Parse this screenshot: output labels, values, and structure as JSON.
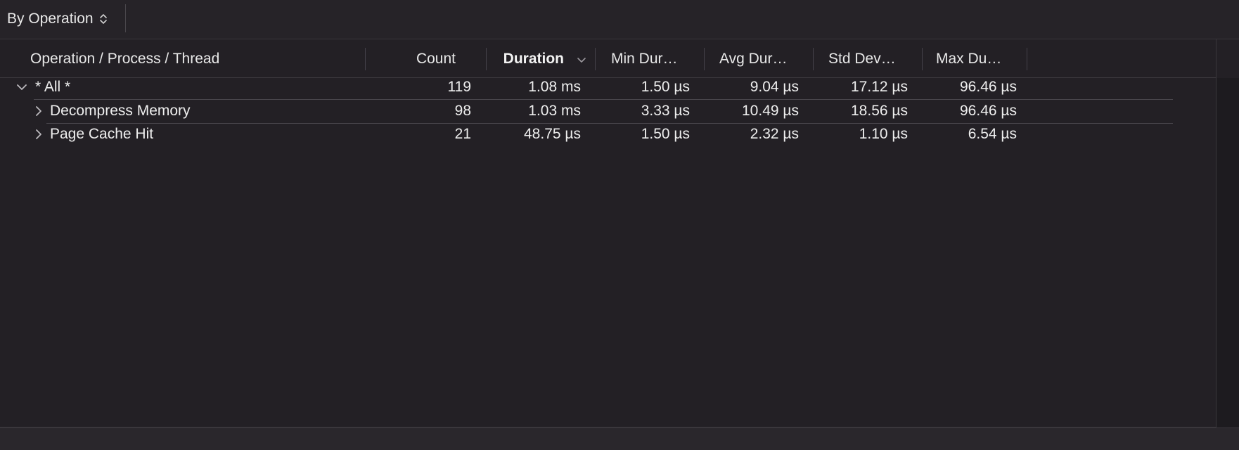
{
  "toolbar": {
    "scope_label": "By Operation"
  },
  "columns": [
    {
      "key": "name",
      "label": "Operation / Process / Thread"
    },
    {
      "key": "count",
      "label": "Count"
    },
    {
      "key": "duration",
      "label": "Duration"
    },
    {
      "key": "min",
      "label": "Min Dur…"
    },
    {
      "key": "avg",
      "label": "Avg Dur…"
    },
    {
      "key": "std",
      "label": "Std Dev…"
    },
    {
      "key": "max",
      "label": "Max Du…"
    }
  ],
  "rows": [
    {
      "name": "* All *",
      "expanded": true,
      "count": "119",
      "duration": "1.08 ms",
      "min": "1.50 µs",
      "avg": "9.04 µs",
      "std": "17.12 µs",
      "max": "96.46 µs"
    },
    {
      "name": "Decompress Memory",
      "expanded": false,
      "count": "98",
      "duration": "1.03 ms",
      "min": "3.33 µs",
      "avg": "10.49 µs",
      "std": "18.56 µs",
      "max": "96.46 µs"
    },
    {
      "name": "Page Cache Hit",
      "expanded": false,
      "count": "21",
      "duration": "48.75 µs",
      "min": "1.50 µs",
      "avg": "2.32 µs",
      "std": "1.10 µs",
      "max": "6.54 µs"
    }
  ],
  "icons": {
    "scope": "up-down-chevron-icon",
    "sort": "chevron-down-icon",
    "expanded": "chevron-down-icon",
    "collapsed": "chevron-right-icon"
  },
  "colors": {
    "background": "#232025",
    "text": "#e8e8e8",
    "separator": "#48454b"
  }
}
